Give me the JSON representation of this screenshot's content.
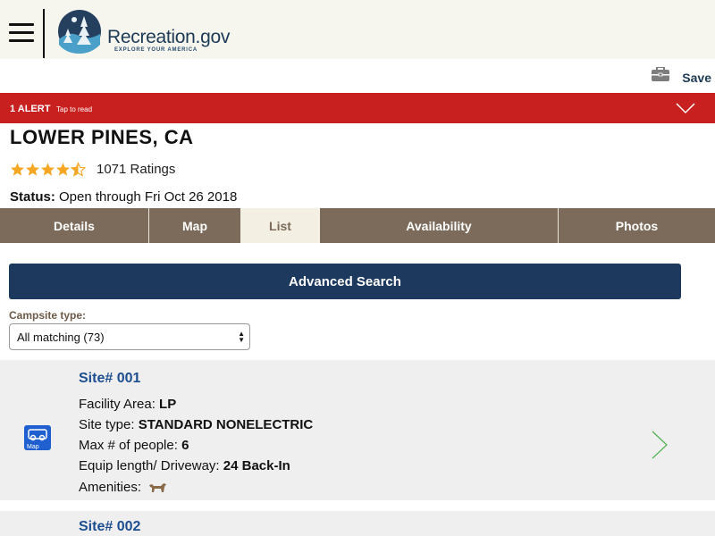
{
  "header": {
    "logo_text": "Recreation.gov",
    "logo_tagline": "EXPLORE YOUR AMERICA",
    "save_label": "Save"
  },
  "alert": {
    "count_label": "1 ALERT",
    "tap_label": "Tap to read",
    "color": "#c8201e"
  },
  "facility": {
    "title": "LOWER PINES, CA",
    "rating": 4.5,
    "rating_max": 5,
    "ratings_count": "1071 Ratings",
    "status_label": "Status:",
    "status_value": "Open through Fri Oct 26 2018"
  },
  "tabs": [
    {
      "label": "Details"
    },
    {
      "label": "Map"
    },
    {
      "label": "List",
      "active": true
    },
    {
      "label": "Availability"
    },
    {
      "label": "Photos"
    }
  ],
  "search": {
    "advanced_label": "Advanced Search",
    "campsite_type_label": "Campsite type:",
    "campsite_type_value": "All matching (73)"
  },
  "sites": [
    {
      "title": "Site# 001",
      "facility_area_label": "Facility Area:",
      "facility_area": "LP",
      "site_type_label": "Site type:",
      "site_type": "STANDARD NONELECTRIC",
      "max_people_label": "Max # of people:",
      "max_people": "6",
      "equip_label": "Equip length/ Driveway:",
      "equip": "24 Back-In",
      "amenities_label": "Amenities:",
      "map_label": "Map"
    },
    {
      "title": "Site# 002"
    }
  ],
  "colors": {
    "brand_navy": "#1d3a5e",
    "tab_brown": "#7c6b5a",
    "link_blue": "#1d4e8f",
    "star": "#f5a623"
  }
}
